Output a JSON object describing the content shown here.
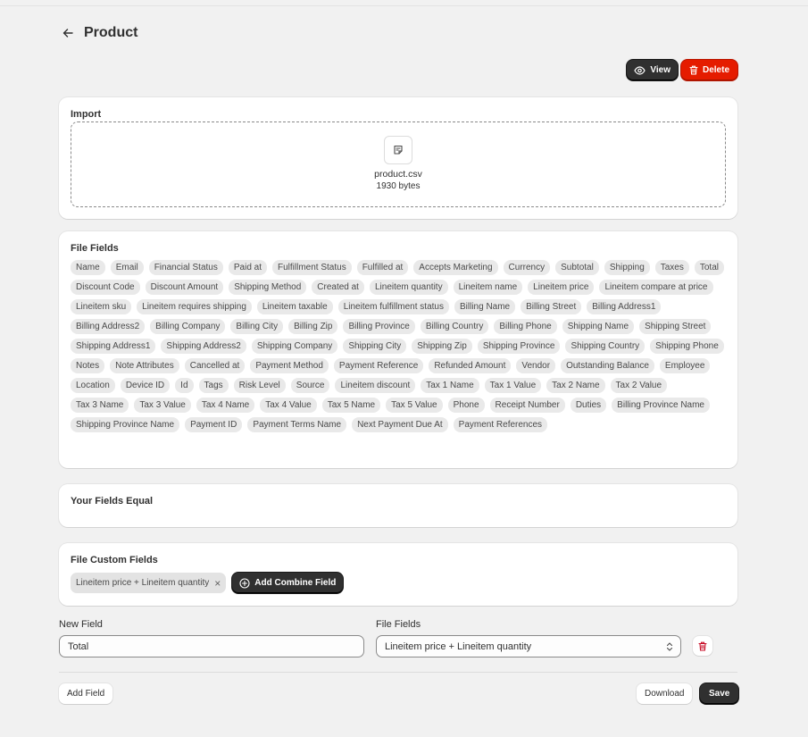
{
  "page": {
    "title": "Product"
  },
  "actions": {
    "view_label": "View",
    "delete_label": "Delete"
  },
  "import": {
    "title": "Import",
    "file_name": "product.csv",
    "file_size": "1930 bytes"
  },
  "file_fields": {
    "title": "File Fields",
    "tags": [
      "Name",
      "Email",
      "Financial Status",
      "Paid at",
      "Fulfillment Status",
      "Fulfilled at",
      "Accepts Marketing",
      "Currency",
      "Subtotal",
      "Shipping",
      "Taxes",
      "Total",
      "Discount Code",
      "Discount Amount",
      "Shipping Method",
      "Created at",
      "Lineitem quantity",
      "Lineitem name",
      "Lineitem price",
      "Lineitem compare at price",
      "Lineitem sku",
      "Lineitem requires shipping",
      "Lineitem taxable",
      "Lineitem fulfillment status",
      "Billing Name",
      "Billing Street",
      "Billing Address1",
      "Billing Address2",
      "Billing Company",
      "Billing City",
      "Billing Zip",
      "Billing Province",
      "Billing Country",
      "Billing Phone",
      "Shipping Name",
      "Shipping Street",
      "Shipping Address1",
      "Shipping Address2",
      "Shipping Company",
      "Shipping City",
      "Shipping Zip",
      "Shipping Province",
      "Shipping Country",
      "Shipping Phone",
      "Notes",
      "Note Attributes",
      "Cancelled at",
      "Payment Method",
      "Payment Reference",
      "Refunded Amount",
      "Vendor",
      "Outstanding Balance",
      "Employee",
      "Location",
      "Device ID",
      "Id",
      "Tags",
      "Risk Level",
      "Source",
      "Lineitem discount",
      "Tax 1 Name",
      "Tax 1 Value",
      "Tax 2 Name",
      "Tax 2 Value",
      "Tax 3 Name",
      "Tax 3 Value",
      "Tax 4 Name",
      "Tax 4 Value",
      "Tax 5 Name",
      "Tax 5 Value",
      "Phone",
      "Receipt Number",
      "Duties",
      "Billing Province Name",
      "Shipping Province Name",
      "Payment ID",
      "Payment Terms Name",
      "Next Payment Due At",
      "Payment References"
    ]
  },
  "equal": {
    "title": "Your Fields Equal"
  },
  "custom": {
    "title": "File Custom Fields",
    "chip_label": "Lineitem price + Lineitem quantity",
    "chip_remove": "×",
    "add_combine_label": "Add Combine Field"
  },
  "new_field": {
    "label": "New Field",
    "value": "Total",
    "file_fields_label": "File Fields",
    "file_fields_value": "Lineitem price + Lineitem quantity"
  },
  "footer": {
    "add_field_label": "Add Field",
    "download_label": "Download",
    "save_label": "Save"
  },
  "icons": {
    "back": "arrow-left-icon",
    "view": "eye-icon",
    "delete": "trash-icon",
    "file": "file-icon",
    "add": "plus-circle-icon",
    "select": "chevron-up-down-icon",
    "remove": "close-icon"
  },
  "colors": {
    "primary": "#303030",
    "critical": "#e51c00",
    "background": "#f1f1f1",
    "tag": "#e9e9e9"
  }
}
